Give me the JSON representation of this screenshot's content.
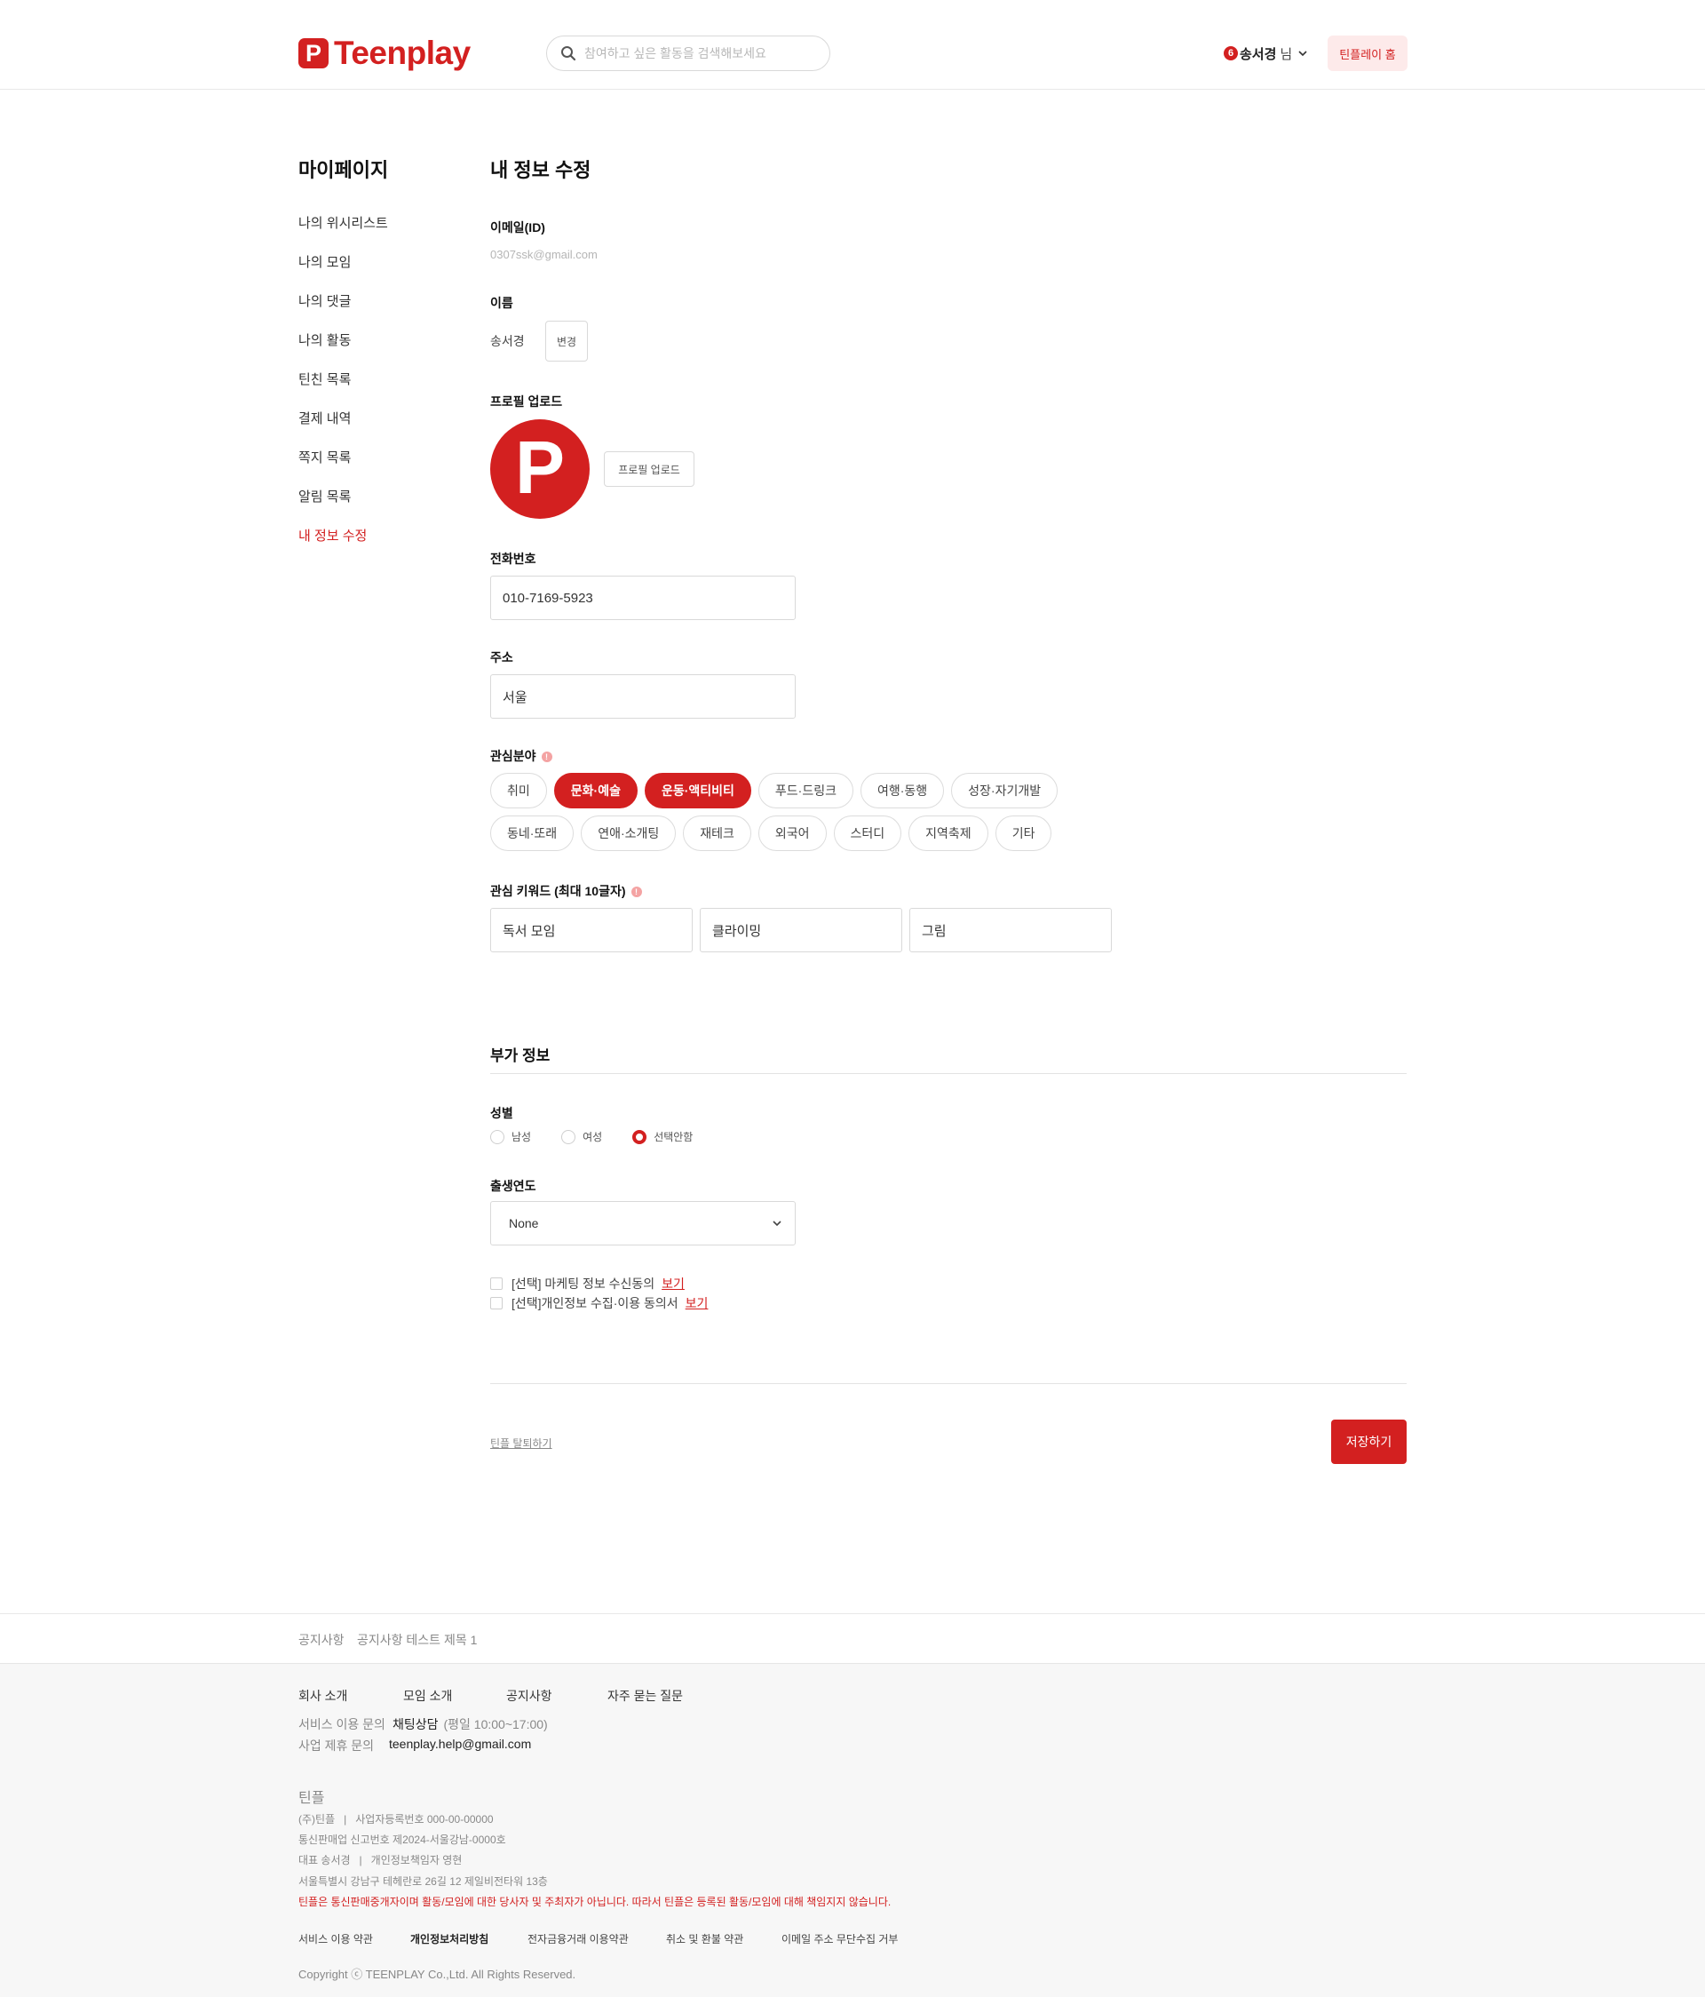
{
  "header": {
    "logo_mark": "P",
    "logo_text": "Teenplay",
    "search_placeholder": "참여하고 싶은 활동을 검색해보세요",
    "user_badge": "6",
    "user_name": "송서경",
    "user_suffix": "님",
    "home_button": "틴플레이 홈"
  },
  "sidebar": {
    "title": "마이페이지",
    "items": [
      {
        "label": "나의 위시리스트",
        "active": false
      },
      {
        "label": "나의 모임",
        "active": false
      },
      {
        "label": "나의 댓글",
        "active": false
      },
      {
        "label": "나의 활동",
        "active": false
      },
      {
        "label": "틴친 목록",
        "active": false
      },
      {
        "label": "결제 내역",
        "active": false
      },
      {
        "label": "쪽지 목록",
        "active": false
      },
      {
        "label": "알림 목록",
        "active": false
      },
      {
        "label": "내 정보 수정",
        "active": true
      }
    ]
  },
  "form": {
    "title": "내 정보 수정",
    "email_label": "이메일(ID)",
    "email_value": "0307ssk@gmail.com",
    "name_label": "이름",
    "name_value": "송서경",
    "name_change_button": "변경",
    "profile_label": "프로필 업로드",
    "avatar_letter": "P",
    "profile_upload_button": "프로필 업로드",
    "phone_label": "전화번호",
    "phone_value": "010-7169-5923",
    "address_label": "주소",
    "address_value": "서울",
    "interest_label": "관심분야",
    "interest_rows": [
      [
        {
          "label": "취미",
          "selected": false
        },
        {
          "label": "문화·예술",
          "selected": true
        },
        {
          "label": "운동·액티비티",
          "selected": true
        },
        {
          "label": "푸드·드링크",
          "selected": false
        },
        {
          "label": "여행·동행",
          "selected": false
        },
        {
          "label": "성장·자기개발",
          "selected": false
        }
      ],
      [
        {
          "label": "동네·또래",
          "selected": false
        },
        {
          "label": "연애·소개팅",
          "selected": false
        },
        {
          "label": "재테크",
          "selected": false
        },
        {
          "label": "외국어",
          "selected": false
        },
        {
          "label": "스터디",
          "selected": false
        },
        {
          "label": "지역축제",
          "selected": false
        },
        {
          "label": "기타",
          "selected": false
        }
      ]
    ],
    "keyword_label": "관심 키워드 (최대 10글자)",
    "keywords": [
      "독서 모임",
      "클라이밍",
      "그림"
    ],
    "extra_section_title": "부가 정보",
    "gender_label": "성별",
    "gender_options": [
      {
        "label": "남성",
        "checked": false
      },
      {
        "label": "여성",
        "checked": false
      },
      {
        "label": "선택안함",
        "checked": true
      }
    ],
    "birth_label": "출생연도",
    "birth_value": "None",
    "consents": [
      {
        "label": "[선택] 마케팅 정보 수신동의",
        "link": "보기"
      },
      {
        "label": "[선택]개인정보 수집·이용 동의서",
        "link": "보기"
      }
    ],
    "withdraw_link": "틴플 탈퇴하기",
    "save_button": "저장하기"
  },
  "footer": {
    "notice_label": "공지사항",
    "notice_text": "공지사항 테스트 제목 1",
    "links": [
      "회사 소개",
      "모임 소개",
      "공지사항",
      "자주 묻는 질문"
    ],
    "service_label": "서비스 이용 문의",
    "service_value": "채팅상담",
    "service_hours": "(평일 10:00~17:00)",
    "business_label": "사업 제휴 문의",
    "business_value": "teenplay.help@gmail.com",
    "company_name": "틴플",
    "company_lines": [
      "(주)틴플   |   사업자등록번호 000-00-00000",
      "통신판매업 신고번호 제2024-서울강남-0000호",
      "대표 송서경   |   개인정보책임자 영현",
      "서울특별시 강남구 테헤란로 26길 12 제일비전타워 13층"
    ],
    "disclaimer": "틴플은 통신판매중개자이며 활동/모임에 대한 당사자 및 주최자가 아닙니다. 따라서 틴플은 등록된 활동/모임에 대해 책임지지 않습니다.",
    "policy_links": [
      {
        "label": "서비스 이용 약관",
        "bold": false
      },
      {
        "label": "개인정보처리방침",
        "bold": true
      },
      {
        "label": "전자금융거래 이용약관",
        "bold": false
      },
      {
        "label": "취소 및 환불 약관",
        "bold": false
      },
      {
        "label": "이메일 주소 무단수집 거부",
        "bold": false
      }
    ],
    "copyright": "Copyright ⓒ TEENPLAY Co.,Ltd. All Rights Reserved."
  },
  "colors": {
    "brand": "#d32020",
    "brand_light": "#fdeaea"
  }
}
